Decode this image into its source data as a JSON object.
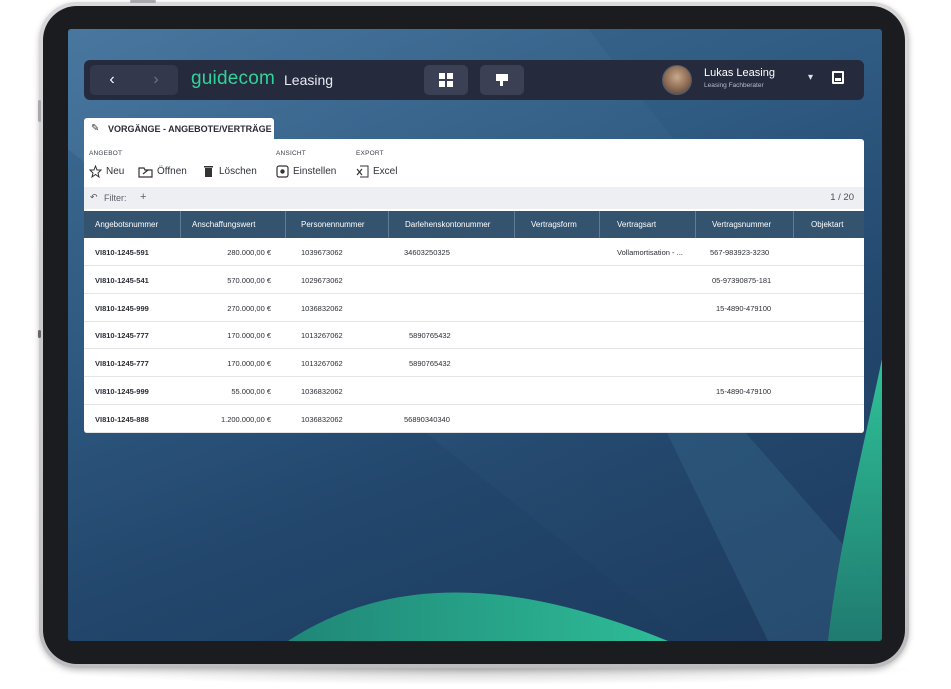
{
  "app": {
    "logo": "guidecom",
    "module": "Leasing",
    "back_glyph": "‹",
    "forward_glyph": "›"
  },
  "user": {
    "name": "Lukas Leasing",
    "role": "Leasing Fachberater"
  },
  "tab": {
    "label": "VORGÄNGE - ANGEBOTE/VERTRÄGE"
  },
  "toolbar": {
    "groups": [
      {
        "label": "ANGEBOT",
        "buttons": [
          "Neu",
          "Öffnen",
          "Löschen"
        ]
      },
      {
        "label": "ANSICHT",
        "buttons": [
          "Einstellen"
        ]
      },
      {
        "label": "EXPORT",
        "buttons": [
          "Excel"
        ]
      }
    ]
  },
  "filter": {
    "label": "Filter:",
    "add": "+",
    "pager": "1 / 20"
  },
  "table": {
    "columns": [
      "Angebotsnummer",
      "Anschaffungswert",
      "Personennummer",
      "Darlehenskontonummer",
      "Vertragsform",
      "Vertragsart",
      "Vertragsnummer",
      "Objektart"
    ],
    "rows": [
      [
        "VI810-1245-591",
        "280.000,00 €",
        "1039673062",
        "34603250325",
        "",
        "Vollamortisation - ...",
        "567-983923-3230",
        ""
      ],
      [
        "VI810-1245-541",
        "570.000,00 €",
        "1029673062",
        "",
        "",
        "",
        "05-97390875-181",
        ""
      ],
      [
        "VI810-1245-999",
        "270.000,00 €",
        "1036832062",
        "",
        "",
        "",
        "15-4890-479100",
        ""
      ],
      [
        "VI810-1245-777",
        "170.000,00 €",
        "1013267062",
        "5890765432",
        "",
        "",
        "",
        ""
      ],
      [
        "VI810-1245-777",
        "170.000,00 €",
        "1013267062",
        "5890765432",
        "",
        "",
        "",
        ""
      ],
      [
        "VI810-1245-999",
        "55.000,00 €",
        "1036832062",
        "",
        "",
        "",
        "15-4890-479100",
        ""
      ],
      [
        "VI810-1245-888",
        "1.200.000,00 €",
        "1036832062",
        "56890340340",
        "",
        "",
        "",
        ""
      ]
    ]
  },
  "colors": {
    "accent": "#2fd39a",
    "header": "#33536f",
    "appbar": "#262a3d"
  }
}
